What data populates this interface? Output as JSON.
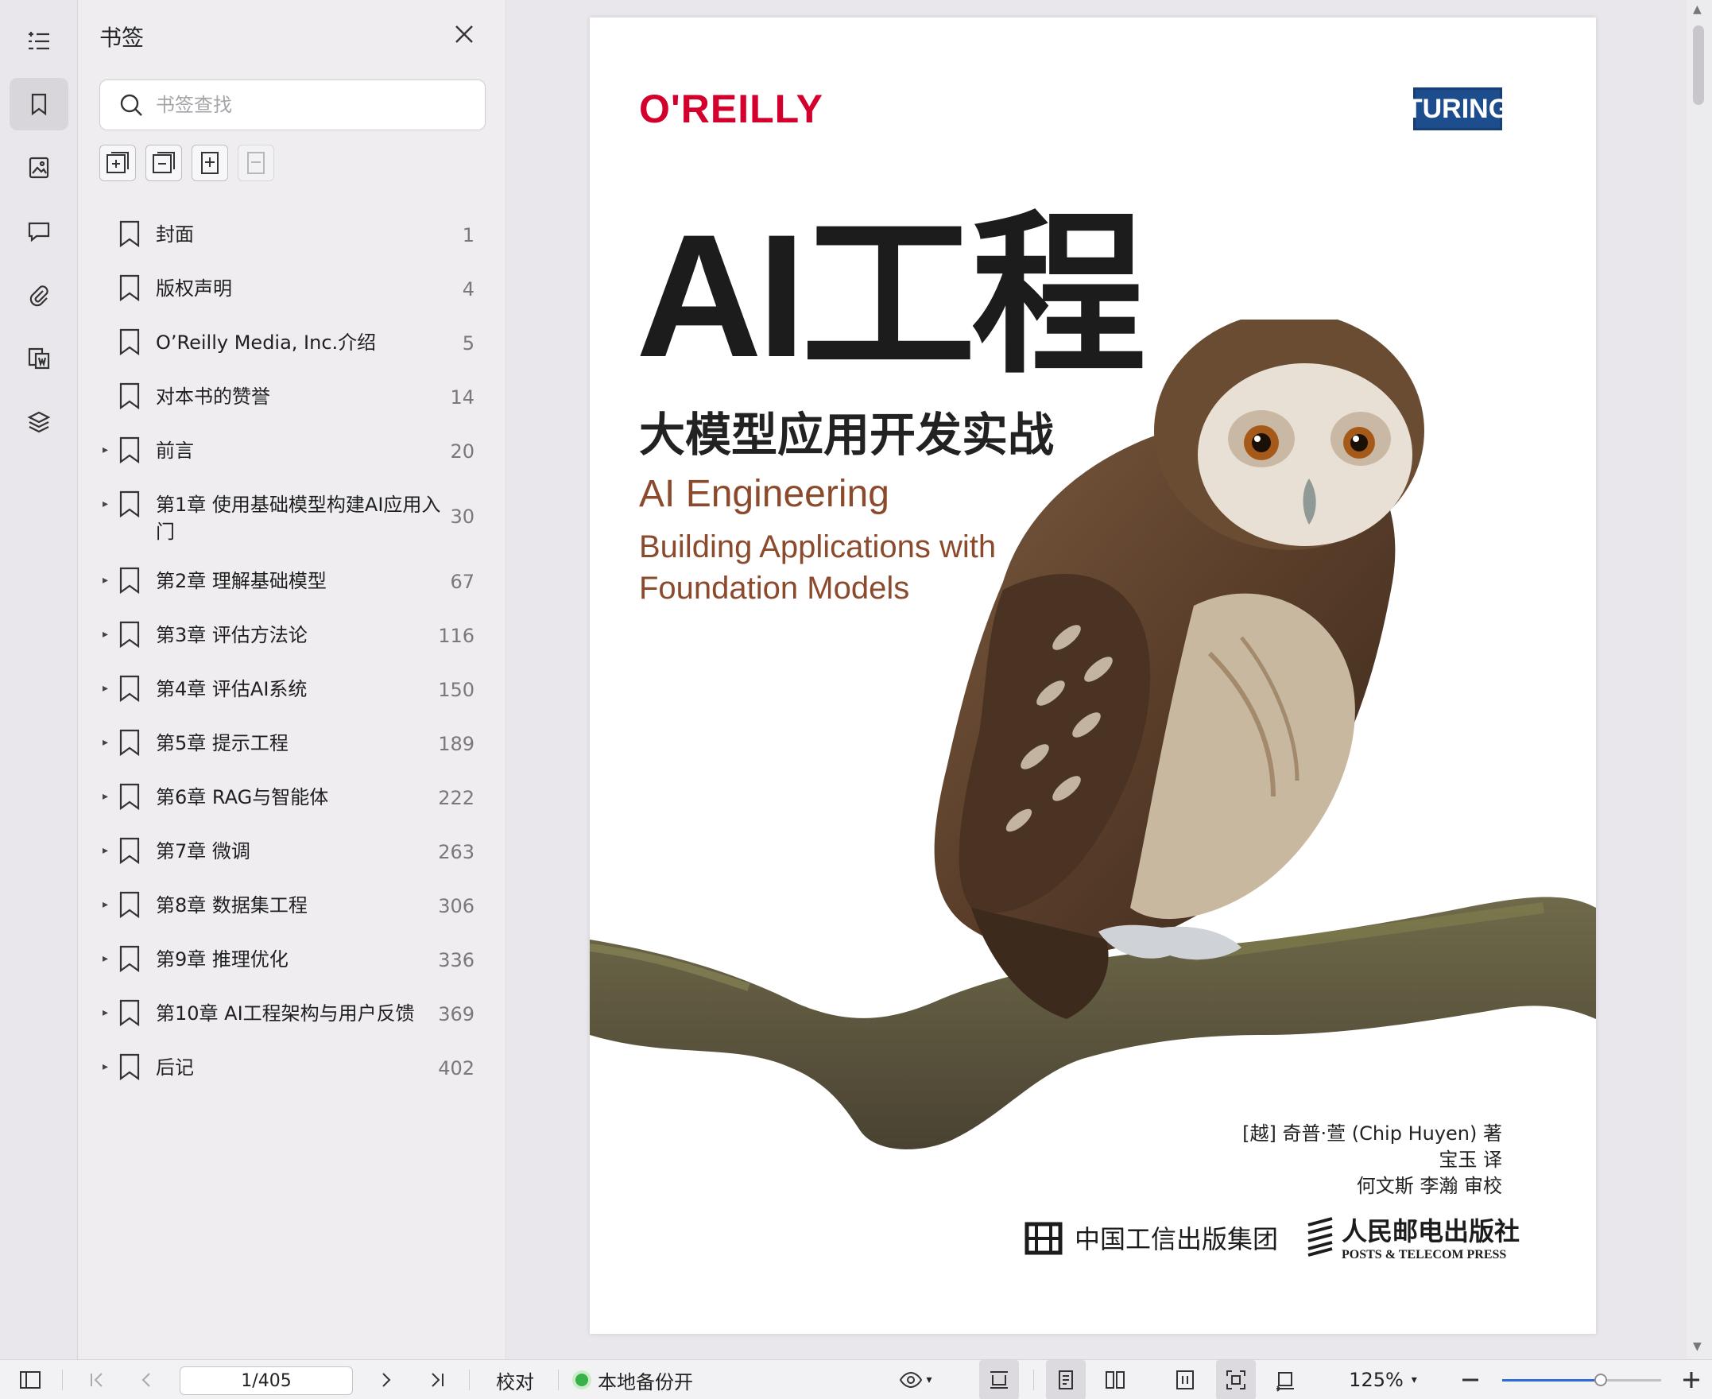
{
  "sidebar_rail": {
    "items": [
      {
        "name": "outline-icon"
      },
      {
        "name": "bookmark-icon",
        "active": true
      },
      {
        "name": "thumbnail-icon"
      },
      {
        "name": "comment-icon"
      },
      {
        "name": "attachment-icon"
      },
      {
        "name": "extract-page-icon"
      },
      {
        "name": "layers-icon"
      }
    ]
  },
  "bookmarks_panel": {
    "title": "书签",
    "search_placeholder": "书签查找",
    "items": [
      {
        "label": "封面",
        "page": "1",
        "expandable": false
      },
      {
        "label": "版权声明",
        "page": "4",
        "expandable": false
      },
      {
        "label": "O’Reilly Media, Inc.介绍",
        "page": "5",
        "expandable": false
      },
      {
        "label": "对本书的赞誉",
        "page": "14",
        "expandable": false
      },
      {
        "label": "前言",
        "page": "20",
        "expandable": true
      },
      {
        "label": "第1章 使用基础模型构建AI应用入门",
        "page": "30",
        "expandable": true
      },
      {
        "label": "第2章 理解基础模型",
        "page": "67",
        "expandable": true
      },
      {
        "label": "第3章 评估方法论",
        "page": "116",
        "expandable": true
      },
      {
        "label": "第4章 评估AI系统",
        "page": "150",
        "expandable": true
      },
      {
        "label": "第5章 提示工程",
        "page": "189",
        "expandable": true
      },
      {
        "label": "第6章 RAG与智能体",
        "page": "222",
        "expandable": true
      },
      {
        "label": "第7章 微调",
        "page": "263",
        "expandable": true
      },
      {
        "label": "第8章 数据集工程",
        "page": "306",
        "expandable": true
      },
      {
        "label": "第9章 推理优化",
        "page": "336",
        "expandable": true
      },
      {
        "label": "第10章 AI工程架构与用户反馈",
        "page": "369",
        "expandable": true
      },
      {
        "label": "后记",
        "page": "402",
        "expandable": true
      }
    ]
  },
  "cover": {
    "publisher_logo": "O'REILLY",
    "series_logo": "TURING",
    "title": "AI工程",
    "subtitle": "大模型应用开发实战",
    "title_en": "AI Engineering",
    "subtitle_en": "Building Applications with Foundation Models",
    "author_line": "[越] 奇普·萱 (Chip Huyen) 著",
    "translator_line": "宝玉 译",
    "reviewer_line": "何文斯 李瀚 审校",
    "publisher1": "中国工信出版集团",
    "publisher2_cn": "人民邮电出版社",
    "publisher2_en": "POSTS & TELECOM PRESS"
  },
  "statusbar": {
    "page_indicator": "1/405",
    "proofread_label": "校对",
    "backup_label": "本地备份开",
    "zoom_label": "125%",
    "zoom_fraction": 0.62,
    "colors": {
      "accent": "#2f6bd8",
      "backup_on": "#3ab24a"
    }
  }
}
